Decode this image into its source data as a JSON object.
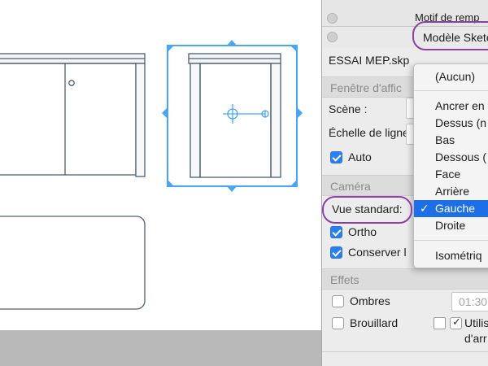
{
  "panel": {
    "title": "Motif de remp",
    "style_selector": "Modèle Sketc",
    "file_name": "ESSAI MEP.skp",
    "section_window": "Fenêtre d'affic",
    "scene_label": "Scène :",
    "line_scale_label": "Échelle de ligne",
    "auto_label": "Auto",
    "section_camera": "Caméra",
    "standard_view_label": "Vue standard:",
    "ortho_label": "Ortho",
    "keep_label": "Conserver l",
    "section_effects": "Effets",
    "shadows_label": "Ombres",
    "shadow_time": "01:30",
    "fog_label": "Brouillard",
    "use_label": "Utilis",
    "use_label2": "d'arr"
  },
  "checks": {
    "auto": true,
    "ortho": true,
    "keep": true,
    "shadows": false,
    "fog": false,
    "use": true
  },
  "menu": {
    "items": [
      {
        "label": "(Aucun)"
      },
      {
        "label": "Ancrer en"
      },
      {
        "label": "Dessus (n"
      },
      {
        "label": "Bas"
      },
      {
        "label": "Dessous ("
      },
      {
        "label": "Face"
      },
      {
        "label": "Arrière"
      },
      {
        "label": "Gauche",
        "selected": true
      },
      {
        "label": "Droite"
      },
      {
        "label": "Isométriq"
      }
    ],
    "check_mark": "✓"
  },
  "colors": {
    "selection": "#47a6f5",
    "annotation": "#8d3fa6",
    "menu_highlight": "#1d6fe8",
    "drawing_line": "#4b5f73"
  }
}
